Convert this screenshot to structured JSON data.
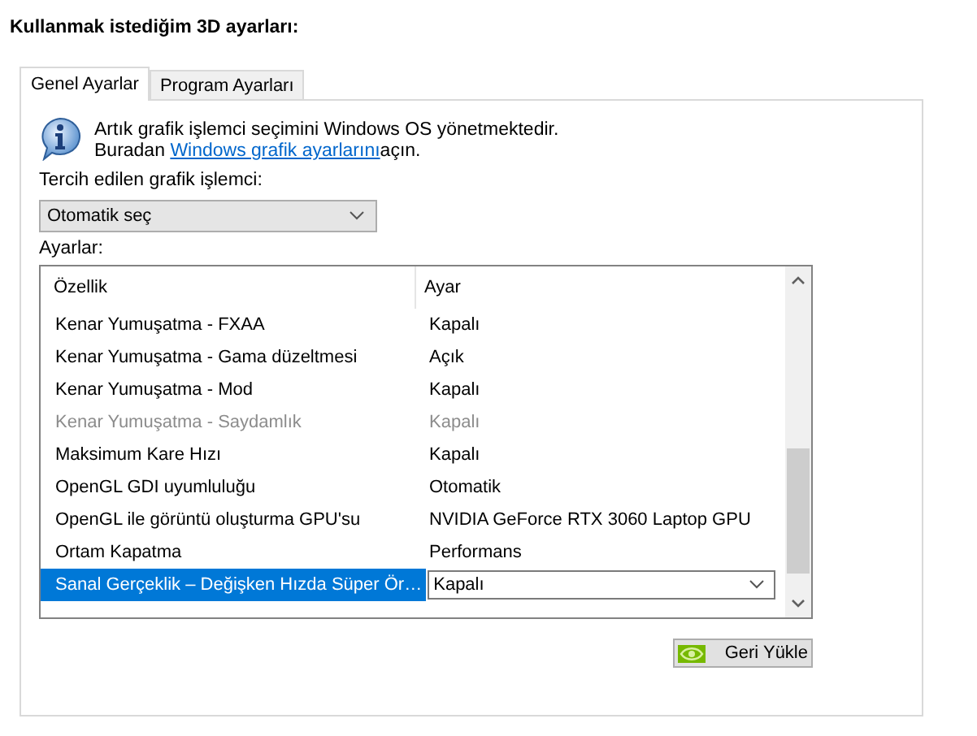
{
  "heading": "Kullanmak istediğim 3D ayarları:",
  "tabs": [
    {
      "label": "Genel Ayarlar",
      "selected": true
    },
    {
      "label": "Program Ayarları",
      "selected": false
    }
  ],
  "info": {
    "line1": "Artık grafik işlemci seçimini Windows OS yönetmektedir.",
    "line2_before": "Buradan ",
    "link": "Windows grafik ayarlarını",
    "line2_after": "açın."
  },
  "gpu_label": "Tercih edilen grafik işlemci:",
  "gpu_select": {
    "value": "Otomatik seç"
  },
  "settings_label": "Ayarlar:",
  "table": {
    "columns": [
      "Özellik",
      "Ayar"
    ],
    "rows": [
      {
        "property": "Kenar Yumuşatma - FXAA",
        "value": "Kapalı",
        "disabled": false,
        "selected": false
      },
      {
        "property": "Kenar Yumuşatma - Gama düzeltmesi",
        "value": "Açık",
        "disabled": false,
        "selected": false
      },
      {
        "property": "Kenar Yumuşatma - Mod",
        "value": "Kapalı",
        "disabled": false,
        "selected": false
      },
      {
        "property": "Kenar Yumuşatma - Saydamlık",
        "value": "Kapalı",
        "disabled": true,
        "selected": false
      },
      {
        "property": "Maksimum Kare Hızı",
        "value": "Kapalı",
        "disabled": false,
        "selected": false
      },
      {
        "property": "OpenGL GDI uyumluluğu",
        "value": "Otomatik",
        "disabled": false,
        "selected": false
      },
      {
        "property": "OpenGL ile görüntü oluşturma GPU'su",
        "value": "NVIDIA GeForce RTX 3060 Laptop GPU",
        "disabled": false,
        "selected": false
      },
      {
        "property": "Ortam Kapatma",
        "value": "Performans",
        "disabled": false,
        "selected": false
      },
      {
        "property": "Sanal Gerçeklik – Değişken Hızda Süper Ör…",
        "value": "Kapalı",
        "disabled": false,
        "selected": true
      }
    ]
  },
  "restore_button": {
    "label": "Geri Yükle"
  }
}
